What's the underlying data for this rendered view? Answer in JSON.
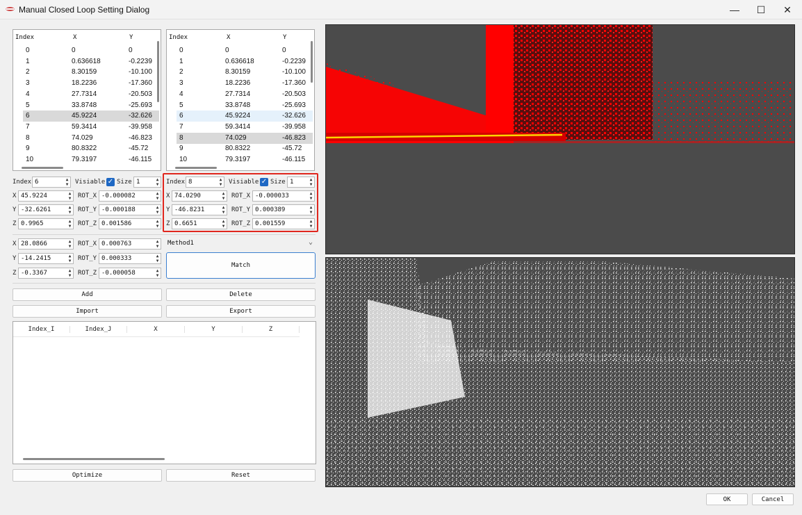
{
  "window": {
    "title": "Manual Closed Loop Setting Dialog",
    "minimize": "—",
    "maximize": "☐",
    "close": "✕"
  },
  "list_left": {
    "headers": [
      "Index",
      "X",
      "Y"
    ],
    "rows": [
      [
        "0",
        "0",
        "0"
      ],
      [
        "1",
        "0.636618",
        "-0.2239"
      ],
      [
        "2",
        "8.30159",
        "-10.100"
      ],
      [
        "3",
        "18.2236",
        "-17.360"
      ],
      [
        "4",
        "27.7314",
        "-20.503"
      ],
      [
        "5",
        "33.8748",
        "-25.693"
      ],
      [
        "6",
        "45.9224",
        "-32.626"
      ],
      [
        "7",
        "59.3414",
        "-39.958"
      ],
      [
        "8",
        "74.029",
        "-46.823"
      ],
      [
        "9",
        "80.8322",
        "-45.72"
      ],
      [
        "10",
        "79.3197",
        "-46.115"
      ]
    ]
  },
  "list_right": {
    "headers": [
      "Index",
      "X",
      "Y"
    ],
    "rows": [
      [
        "0",
        "0",
        "0"
      ],
      [
        "1",
        "0.636618",
        "-0.2239"
      ],
      [
        "2",
        "8.30159",
        "-10.100"
      ],
      [
        "3",
        "18.2236",
        "-17.360"
      ],
      [
        "4",
        "27.7314",
        "-20.503"
      ],
      [
        "5",
        "33.8748",
        "-25.693"
      ],
      [
        "6",
        "45.9224",
        "-32.626"
      ],
      [
        "7",
        "59.3414",
        "-39.958"
      ],
      [
        "8",
        "74.029",
        "-46.823"
      ],
      [
        "9",
        "80.8322",
        "-45.72"
      ],
      [
        "10",
        "79.3197",
        "-46.115"
      ]
    ]
  },
  "left_point": {
    "index_label": "Index",
    "index": "6",
    "visible_label": "Visiable",
    "size_label": "Size",
    "size": "1",
    "x_label": "X",
    "x": "45.9224",
    "y_label": "Y",
    "y": "-32.6261",
    "z_label": "Z",
    "z": "0.9965",
    "rotx_label": "ROT_X",
    "rotx": "-0.000082",
    "roty_label": "ROT_Y",
    "roty": "-0.000188",
    "rotz_label": "ROT_Z",
    "rotz": "0.001586"
  },
  "right_point": {
    "index_label": "Index",
    "index": "8",
    "visible_label": "Visiable",
    "size_label": "Size",
    "size": "1",
    "x_label": "X",
    "x": "74.0290",
    "y_label": "Y",
    "y": "-46.8231",
    "z_label": "Z",
    "z": "0.6651",
    "rotx_label": "ROT_X",
    "rotx": "-0.000033",
    "roty_label": "ROT_Y",
    "roty": "0.000389",
    "rotz_label": "ROT_Z",
    "rotz": "0.001559"
  },
  "relative": {
    "x_label": "X",
    "x": "28.0866",
    "y_label": "Y",
    "y": "-14.2415",
    "z_label": "Z",
    "z": "-0.3367",
    "rotx_label": "ROT_X",
    "rotx": "0.000763",
    "roty_label": "ROT_Y",
    "roty": "0.000333",
    "rotz_label": "ROT_Z",
    "rotz": "-0.000058"
  },
  "method": {
    "selected": "Method1"
  },
  "buttons": {
    "match": "Match",
    "add": "Add",
    "delete": "Delete",
    "import": "Import",
    "export": "Export",
    "optimize": "Optimize",
    "reset": "Reset",
    "ok": "OK",
    "cancel": "Cancel"
  },
  "pairs_table": {
    "headers": [
      "Index_I",
      "Index_J",
      "X",
      "Y",
      "Z"
    ],
    "rows": []
  },
  "colors": {
    "highlight_border": "#e0261d",
    "checkbox": "#1e68c4",
    "viewport_bg": "#4b4b4b",
    "cloud_top": "#ff0000",
    "cloud_bottom": "#ffffff"
  }
}
